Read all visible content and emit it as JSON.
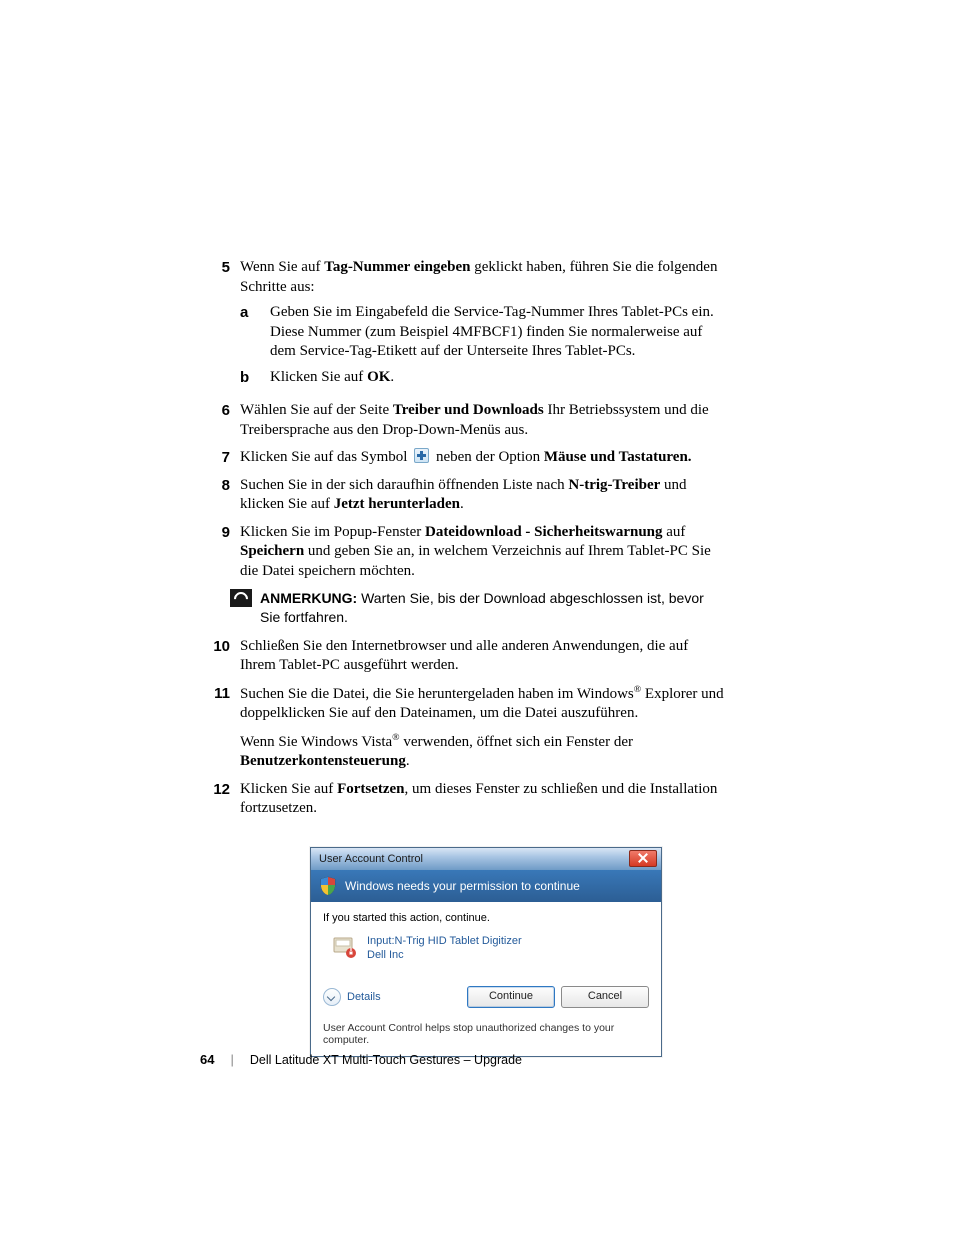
{
  "steps": {
    "s5": {
      "num": "5",
      "pre": "Wenn Sie auf ",
      "bold": "Tag-Nummer eingeben",
      "post": " geklickt haben, führen Sie die folgenden Schritte aus:",
      "a": {
        "letter": "a",
        "text": "Geben Sie im Eingabefeld die Service-Tag-Nummer Ihres Tablet-PCs ein. Diese Nummer (zum Beispiel 4MFBCF1) finden Sie normalerweise auf dem Service-Tag-Etikett auf der Unterseite Ihres Tablet-PCs."
      },
      "b": {
        "letter": "b",
        "pre": "Klicken Sie auf ",
        "bold": "OK",
        "post": "."
      }
    },
    "s6": {
      "num": "6",
      "pre": "Wählen Sie auf der Seite ",
      "bold": "Treiber und Downloads",
      "post": " Ihr Betriebssystem und die Treibersprache aus den Drop-Down-Menüs aus."
    },
    "s7": {
      "num": "7",
      "pre": "Klicken Sie auf das Symbol ",
      "mid": " neben der Option ",
      "bold": "Mäuse und Tastaturen."
    },
    "s8": {
      "num": "8",
      "pre": "Suchen Sie in der sich daraufhin öffnenden Liste nach ",
      "bold1": "N-trig-Treiber",
      "mid": " und klicken Sie auf ",
      "bold2": "Jetzt herunterladen",
      "post": "."
    },
    "s9": {
      "num": "9",
      "pre": "Klicken Sie im Popup-Fenster ",
      "bold1": "Dateidownload - Sicherheitswarnung",
      "mid": " auf ",
      "bold2": "Speichern",
      "post": " und geben Sie an, in welchem Verzeichnis auf Ihrem Tablet-PC Sie die Datei speichern möchten."
    },
    "s10": {
      "num": "10",
      "text": "Schließen Sie den Internetbrowser und alle anderen Anwendungen, die auf Ihrem Tablet-PC ausgeführt werden."
    },
    "s11": {
      "num": "11",
      "p1_pre": "Suchen Sie die Datei, die Sie heruntergeladen haben im Windows",
      "p1_post": " Explorer und doppelklicken Sie auf den Dateinamen, um die Datei auszuführen.",
      "p2_pre": "Wenn Sie Windows Vista",
      "p2_mid": " verwenden, öffnet sich ein Fenster der ",
      "p2_bold": "Benutzerkontensteuerung",
      "p2_post": "."
    },
    "s12": {
      "num": "12",
      "pre": "Klicken Sie auf ",
      "bold": "Fortsetzen",
      "post": ", um dieses Fenster zu schließen und die Installation fortzusetzen."
    }
  },
  "note": {
    "label": "ANMERKUNG:",
    "text": " Warten Sie, bis der Download abgeschlossen ist, bevor Sie fortfahren."
  },
  "reg": "®",
  "uac": {
    "title": "User Account Control",
    "banner": "Windows needs your permission to continue",
    "prompt": "If you started this action, continue.",
    "program_line1": "Input:N-Trig HID Tablet Digitizer",
    "program_line2": "Dell Inc",
    "details": "Details",
    "continue": "Continue",
    "cancel": "Cancel",
    "footer": "User Account Control helps stop unauthorized changes to your computer."
  },
  "footer": {
    "page": "64",
    "sep": "|",
    "text": "Dell Latitude XT Multi-Touch Gestures – Upgrade"
  }
}
